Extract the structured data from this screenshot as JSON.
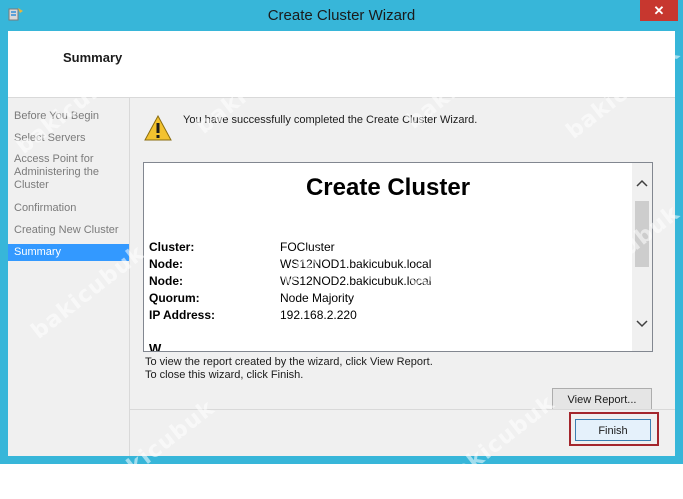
{
  "window": {
    "title": "Create Cluster Wizard",
    "close_glyph": "✕"
  },
  "header": {
    "page_title": "Summary"
  },
  "nav": {
    "items": [
      {
        "label": "Before You Begin"
      },
      {
        "label": "Select Servers"
      },
      {
        "label": "Access Point for"
      },
      {
        "label": "Administering the"
      },
      {
        "label": "Cluster"
      },
      {
        "label": "Confirmation"
      },
      {
        "label": "Creating New Cluster"
      },
      {
        "label": "Summary"
      }
    ],
    "active": "Summary"
  },
  "status": {
    "icon": "warning-icon",
    "message": "You have successfully completed the Create Cluster Wizard."
  },
  "report": {
    "title": "Create Cluster",
    "rows": [
      {
        "key": "Cluster:",
        "value": "FOCluster"
      },
      {
        "key": "Node:",
        "value": "WS12NOD1.bakicubuk.local"
      },
      {
        "key": "Node:",
        "value": "WS12NOD2.bakicubuk.local"
      },
      {
        "key": "Quorum:",
        "value": "Node Majority"
      },
      {
        "key": "IP Address:",
        "value": "192.168.2.220"
      }
    ],
    "partial_heading": "W"
  },
  "info": {
    "line1": "To view the report created by the wizard, click View Report.",
    "line2": "To close this wizard, click Finish."
  },
  "buttons": {
    "view_report": "View Report...",
    "finish": "Finish"
  },
  "watermark": "bakicubuk",
  "colors": {
    "frame": "#37b6d9",
    "close": "#c7372f",
    "nav_active": "#3399ff",
    "highlight": "#a4262c"
  }
}
